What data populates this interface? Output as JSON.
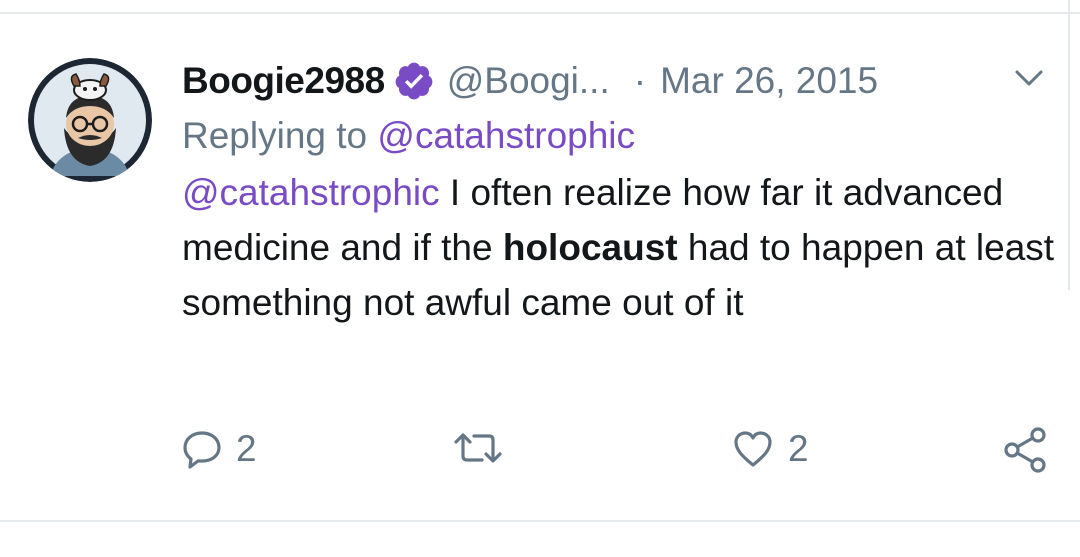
{
  "tweet": {
    "display_name": "Boogie2988",
    "handle": "@Boogi...",
    "separator": "·",
    "timestamp": "Mar 26, 2015",
    "reply_prefix": "Replying to ",
    "reply_to": "@catahstrophic",
    "text_mention": "@catahstrophic",
    "text_part1": " I often realize how far it advanced medicine and if the ",
    "text_bold": "holocaust",
    "text_part2": " had to happen at least something not awful came out of it"
  },
  "actions": {
    "reply_count": "2",
    "retweet_count": "",
    "like_count": "2"
  },
  "icons": {
    "verified": "verified-badge-icon",
    "caret": "chevron-down-icon",
    "reply": "reply-bubble-icon",
    "retweet": "retweet-icon",
    "like": "heart-icon",
    "share": "share-icon"
  },
  "colors": {
    "accent": "#794bc4",
    "text_primary": "#14171a",
    "text_secondary": "#657786",
    "divider": "#e6e9ec"
  }
}
